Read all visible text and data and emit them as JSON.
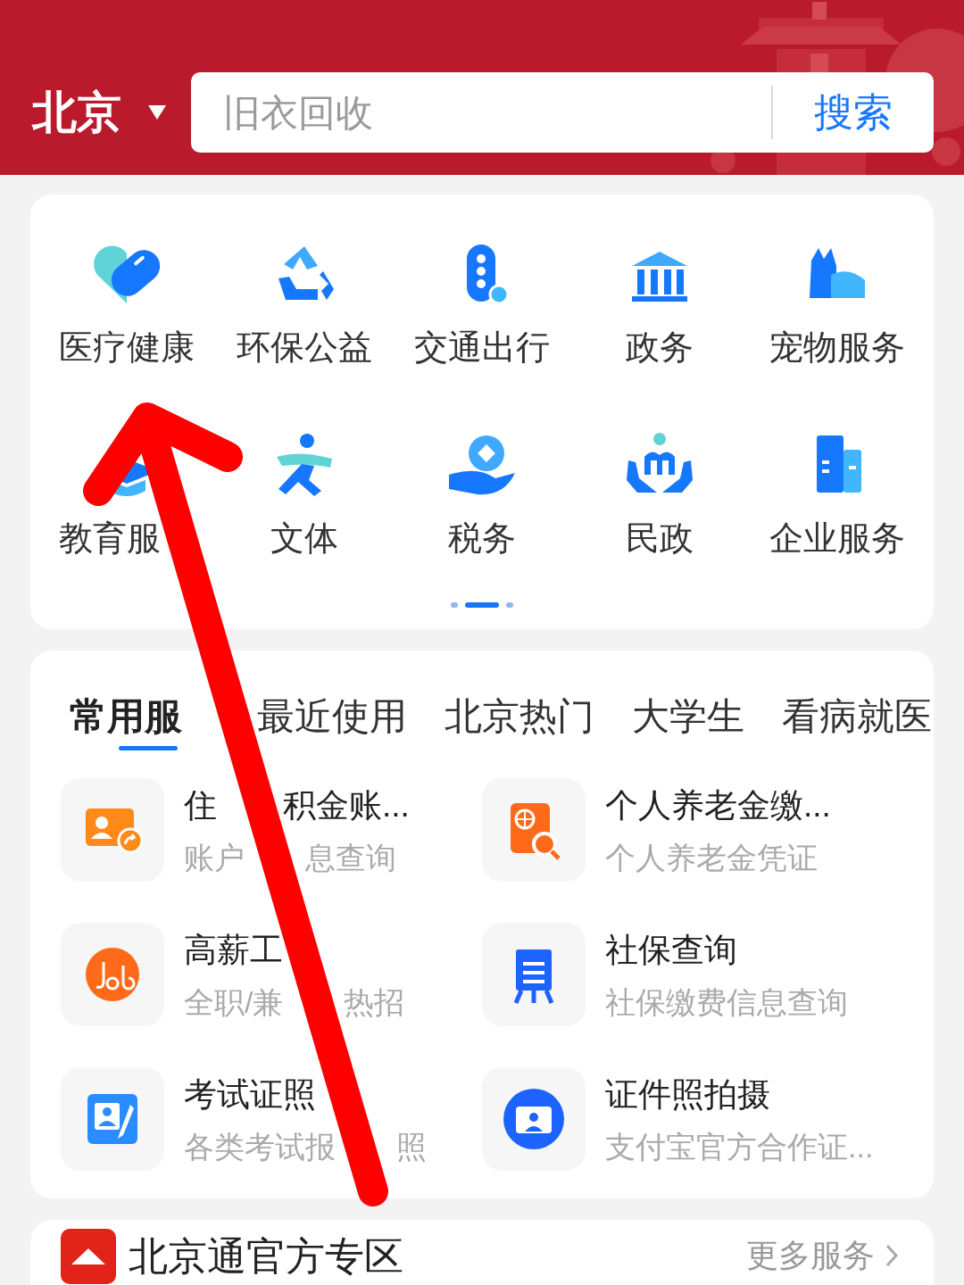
{
  "header": {
    "city": "北京",
    "search": {
      "placeholder": "旧衣回收",
      "button": "搜索"
    }
  },
  "categories": [
    {
      "label": "医疗健康",
      "kind": "heart"
    },
    {
      "label": "环保公益",
      "kind": "recycle"
    },
    {
      "label": "交通出行",
      "kind": "traffic"
    },
    {
      "label": "政务",
      "kind": "building"
    },
    {
      "label": "宠物服务",
      "kind": "pet"
    },
    {
      "label": "教育服",
      "kind": "cap"
    },
    {
      "label": "文体",
      "kind": "runner"
    },
    {
      "label": "税务",
      "kind": "coin"
    },
    {
      "label": "民政",
      "kind": "hands"
    },
    {
      "label": "企业服务",
      "kind": "office"
    }
  ],
  "pager": [
    {
      "selected": false
    },
    {
      "selected": true
    },
    {
      "selected": false
    }
  ],
  "service_tabs": [
    {
      "label": "常用服",
      "selected": true
    },
    {
      "label": "最近使用",
      "selected": false
    },
    {
      "label": "北京热门",
      "selected": false
    },
    {
      "label": "大学生",
      "selected": false
    },
    {
      "label": "看病就医",
      "selected": false
    }
  ],
  "services": [
    {
      "title": [
        "住",
        "积金账..."
      ],
      "subtitle": [
        "账户",
        "息查询"
      ],
      "kind": "card"
    },
    {
      "title": [
        "个人养老金缴..."
      ],
      "subtitle": [
        "个人养老金凭证"
      ],
      "kind": "globe"
    },
    {
      "title": [
        "高薪工"
      ],
      "subtitle": [
        "全职/兼",
        "热招"
      ],
      "kind": "job"
    },
    {
      "title": [
        "社保查询"
      ],
      "subtitle": [
        "社保缴费信息查询"
      ],
      "kind": "board"
    },
    {
      "title": [
        "考试证照"
      ],
      "subtitle": [
        "各类考试报",
        "照"
      ]
    },
    {
      "title": [
        "证件照拍摄"
      ],
      "subtitle": [
        "支付宝官方合作证..."
      ],
      "kind": "camera"
    }
  ],
  "zone": {
    "title": "北京通官方专区",
    "more": "更多服务"
  }
}
